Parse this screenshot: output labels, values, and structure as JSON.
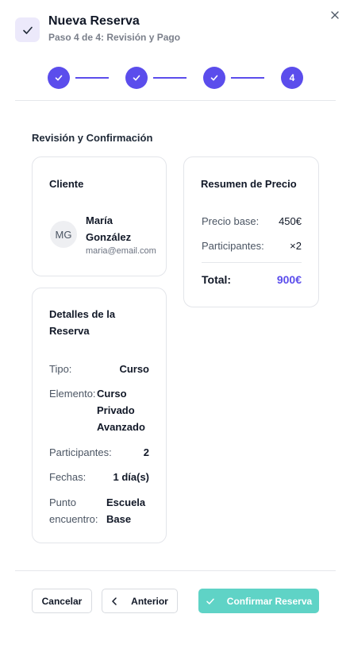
{
  "header": {
    "title": "Nueva Reserva",
    "subtitle": "Paso 4 de 4: Revisión y Pago"
  },
  "stepper": {
    "current_step_label": "4"
  },
  "review": {
    "section_title": "Revisión y Confirmación",
    "client": {
      "card_title": "Cliente",
      "initials": "MG",
      "name": "María González",
      "email": "maria@email.com"
    },
    "details": {
      "card_title": "Detalles de la Reserva",
      "rows": [
        {
          "label": "Tipo:",
          "value": "Curso"
        },
        {
          "label": "Elemento:",
          "value": "Curso Privado Avanzado"
        },
        {
          "label": "Participantes:",
          "value": "2"
        },
        {
          "label": "Fechas:",
          "value": "1 día(s)"
        },
        {
          "label": "Punto encuentro:",
          "value": "Escuela Base"
        }
      ]
    },
    "price": {
      "card_title": "Resumen de Precio",
      "base_label": "Precio base:",
      "base_value": "450€",
      "participants_label": "Participantes:",
      "participants_value": "×2",
      "total_label": "Total:",
      "total_value": "900€"
    }
  },
  "footer": {
    "cancel_label": "Cancelar",
    "back_label": "Anterior",
    "confirm_label": "Confirmar Reserva"
  },
  "colors": {
    "accent": "#5b4dec",
    "confirm": "#5fd3c6",
    "header_icon_bg": "#ece9fb"
  }
}
